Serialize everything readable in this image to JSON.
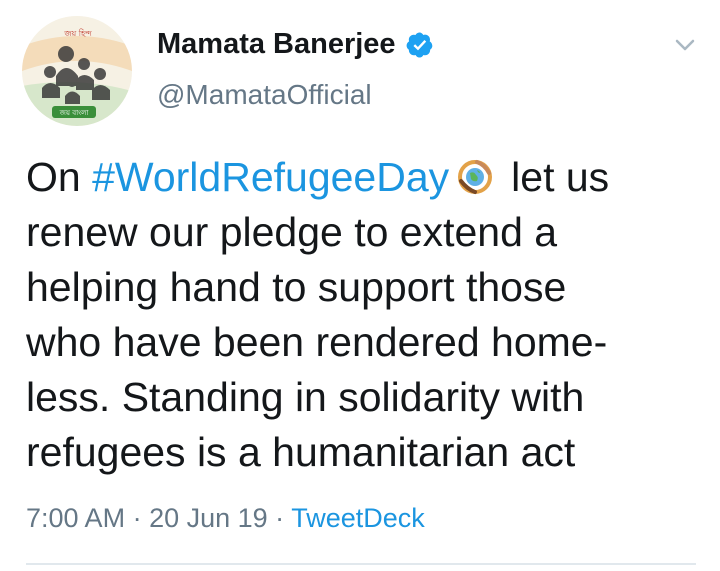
{
  "tweet": {
    "author": {
      "name": "Mamata Banerjee",
      "handle": "@MamataOfficial",
      "verified": true,
      "avatar_top_text": "জয় হিন্দ",
      "avatar_bottom_text": "জয় বাংলা"
    },
    "text": {
      "line1_prefix": "On ",
      "hashtag": "#WorldRefugeeDay",
      "line1_suffix": "let us",
      "line2": "renew our pledge to extend a",
      "line3": "helping hand to support those",
      "line4": "who have been rendered home-",
      "line5": "less. Standing in solidarity with",
      "line6": "refugees is a humanitarian act"
    },
    "meta": {
      "time": "7:00 AM",
      "sep1": " · ",
      "date": "20 Jun 19",
      "sep2": " · ",
      "source": "TweetDeck"
    },
    "icons": {
      "verified": "verified-badge-icon",
      "menu": "chevron-down-icon",
      "emoji": "globe-hands-emoji"
    },
    "colors": {
      "link": "#1b95e0",
      "secondary": "#657786",
      "text": "#14171a",
      "verified": "#1da1f2"
    }
  }
}
